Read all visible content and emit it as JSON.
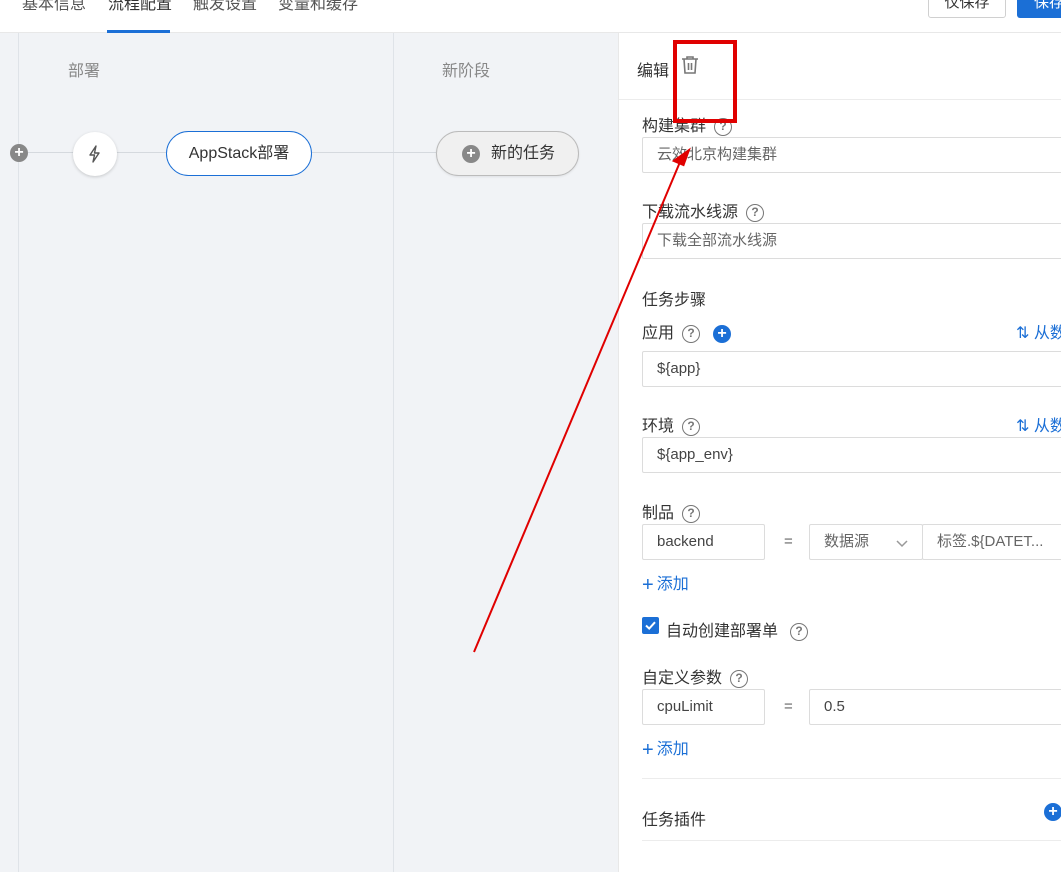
{
  "tabs": [
    {
      "label": "基本信息"
    },
    {
      "label": "流程配置"
    },
    {
      "label": "触发设置"
    },
    {
      "label": "变量和缓存"
    }
  ],
  "buttons": {
    "save_only": "仅保存",
    "save": "保存"
  },
  "canvas": {
    "stages": [
      {
        "title": "部署"
      },
      {
        "title": "新阶段"
      }
    ],
    "task_node": "AppStack部署",
    "new_task": "新的任务"
  },
  "panel": {
    "title": "编辑",
    "build_cluster": {
      "label": "构建集群",
      "value": "云效北京构建集群"
    },
    "download_source": {
      "label": "下载流水线源",
      "value": "下载全部流水线源"
    },
    "steps_title": "任务步骤",
    "app": {
      "label": "应用",
      "value": "${app}",
      "link": "从数"
    },
    "env": {
      "label": "环境",
      "value": "${app_env}",
      "link": "从数"
    },
    "artifact": {
      "label": "制品",
      "name": "backend",
      "eq": "=",
      "source": "数据源",
      "tag": "标签.${DATET..."
    },
    "add_label": "添加",
    "auto_deploy": {
      "label": "自动创建部署单",
      "checked": true
    },
    "custom_params": {
      "label": "自定义参数",
      "name": "cpuLimit",
      "eq": "=",
      "value": "0.5"
    },
    "plugins": {
      "label": "任务插件"
    }
  },
  "colors": {
    "accent": "#1b6fd6",
    "annotation": "#e00000"
  }
}
